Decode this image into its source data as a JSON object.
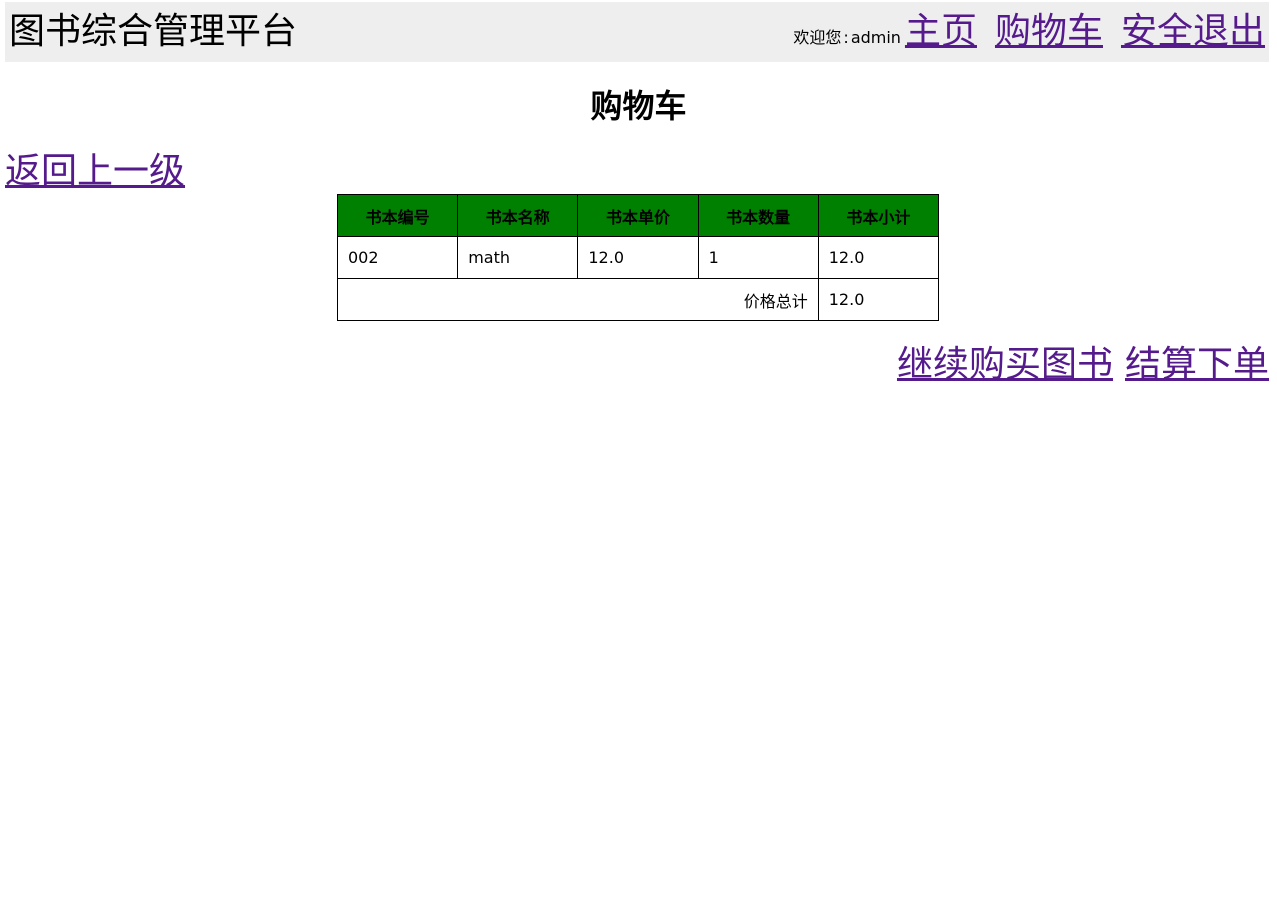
{
  "header": {
    "brand": "图书综合管理平台",
    "welcome_label": "欢迎您",
    "welcome_sep": ":",
    "username": "admin",
    "nav": {
      "home": "主页",
      "cart": "购物车",
      "logout": "安全退出"
    }
  },
  "page_title": "购物车",
  "back_link": "返回上一级",
  "cart_table": {
    "columns": [
      "书本编号",
      "书本名称",
      "书本单价",
      "书本数量",
      "书本小计"
    ],
    "rows": [
      [
        "002",
        "math",
        "12.0",
        "1",
        "12.0"
      ]
    ],
    "total_label": "价格总计",
    "total_value": "12.0"
  },
  "actions": {
    "continue": "继续购买图书",
    "checkout": "结算下单"
  },
  "colors": {
    "header_bg": "#eeeeee",
    "table_header_bg": "#008000",
    "link": "#551a8b"
  }
}
